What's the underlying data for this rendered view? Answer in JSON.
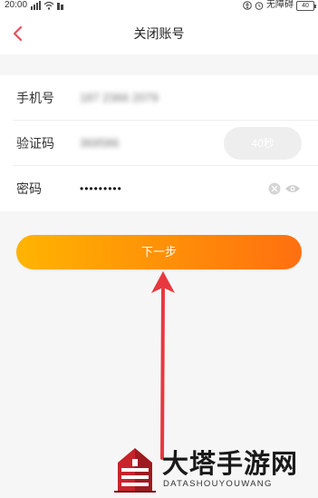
{
  "status_bar": {
    "time": "20:00",
    "accessibility_label": "无障碍",
    "battery": "40"
  },
  "nav": {
    "title": "关闭账号"
  },
  "form": {
    "phone": {
      "label": "手机号",
      "value": "187 2366 2079"
    },
    "code": {
      "label": "验证码",
      "value": "369586",
      "button": "40秒"
    },
    "password": {
      "label": "密码",
      "value": "•••••••••"
    }
  },
  "actions": {
    "next": "下一步"
  },
  "watermark": {
    "title": "大塔手游网",
    "subtitle": "DATASHOUYOUWANG"
  },
  "colors": {
    "accent": "#ff8e08",
    "back_icon": "#e8505b",
    "arrow": "#e8383f"
  }
}
